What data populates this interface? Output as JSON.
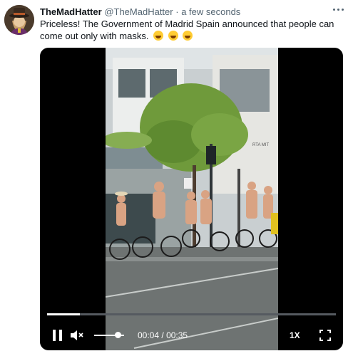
{
  "tweet": {
    "display_name": "TheMadHatter",
    "handle": "@TheMadHatter",
    "separator": "·",
    "timestamp": "a few seconds",
    "text": "Priceless! The Government of Madrid Spain announced that people can come out only with masks.",
    "emojis": [
      "rolling-on-floor-laughing",
      "rolling-on-floor-laughing",
      "rolling-on-floor-laughing"
    ]
  },
  "video": {
    "progress_fraction": 0.114,
    "volume_fraction": 0.8,
    "current_time": "00:04",
    "time_separator": "/",
    "duration": "00:35",
    "playback_speed": "1X"
  },
  "colors": {
    "name_text": "#0f1419",
    "secondary_text": "#536471",
    "video_background": "#000000",
    "control_foreground": "#ffffff"
  }
}
